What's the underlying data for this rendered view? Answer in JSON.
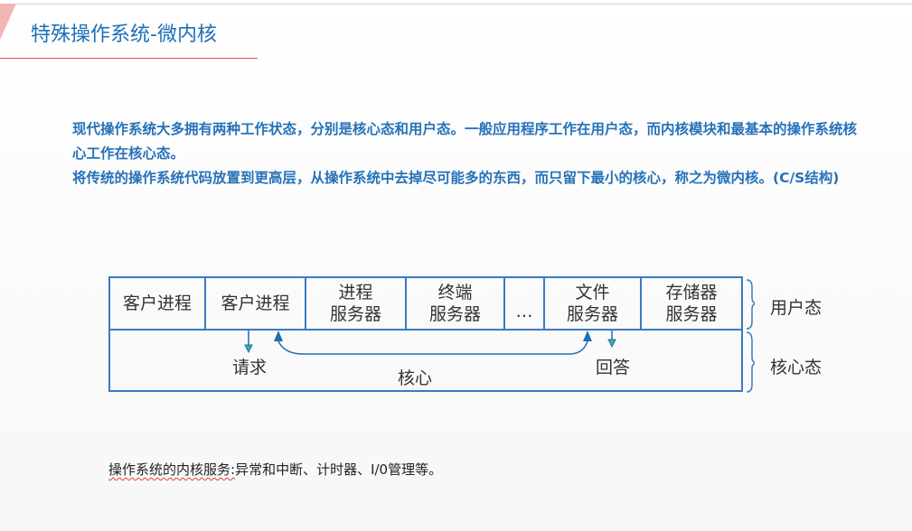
{
  "title": "特殊操作系统-微内核",
  "paragraphs": {
    "p1": "现代操作系统大多拥有两种工作状态，分别是核心态和用户态。一般应用程序工作在用户态，而内核模块和最基本的操作系统核心工作在核心态。",
    "p2": "将传统的操作系统代码放置到更高层，从操作系统中去掉尽可能多的东西，而只留下最小的核心，称之为微内核。(C/S结构)"
  },
  "diagram": {
    "cells": [
      {
        "line1": "客户进程",
        "line2": ""
      },
      {
        "line1": "客户进程",
        "line2": ""
      },
      {
        "line1": "进程",
        "line2": "服务器"
      },
      {
        "line1": "终端",
        "line2": "服务器"
      },
      {
        "line1": "…",
        "line2": ""
      },
      {
        "line1": "文件",
        "line2": "服务器"
      },
      {
        "line1": "存储器",
        "line2": "服务器"
      }
    ],
    "request_label": "请求",
    "reply_label": "回答",
    "kernel_label": "核心",
    "user_mode_label": "用户态",
    "kernel_mode_label": "核心态",
    "line_color": "#3a7bbf",
    "arrow_color": "#1e6fb5"
  },
  "footer": {
    "text_underlined": "操作系统的内核服务:",
    "text_rest": "异常和中断、计时器、I/0管理等。"
  },
  "colors": {
    "title": "#1e6fb5",
    "paragraph": "#2672b8",
    "rule": "#d9534f"
  }
}
